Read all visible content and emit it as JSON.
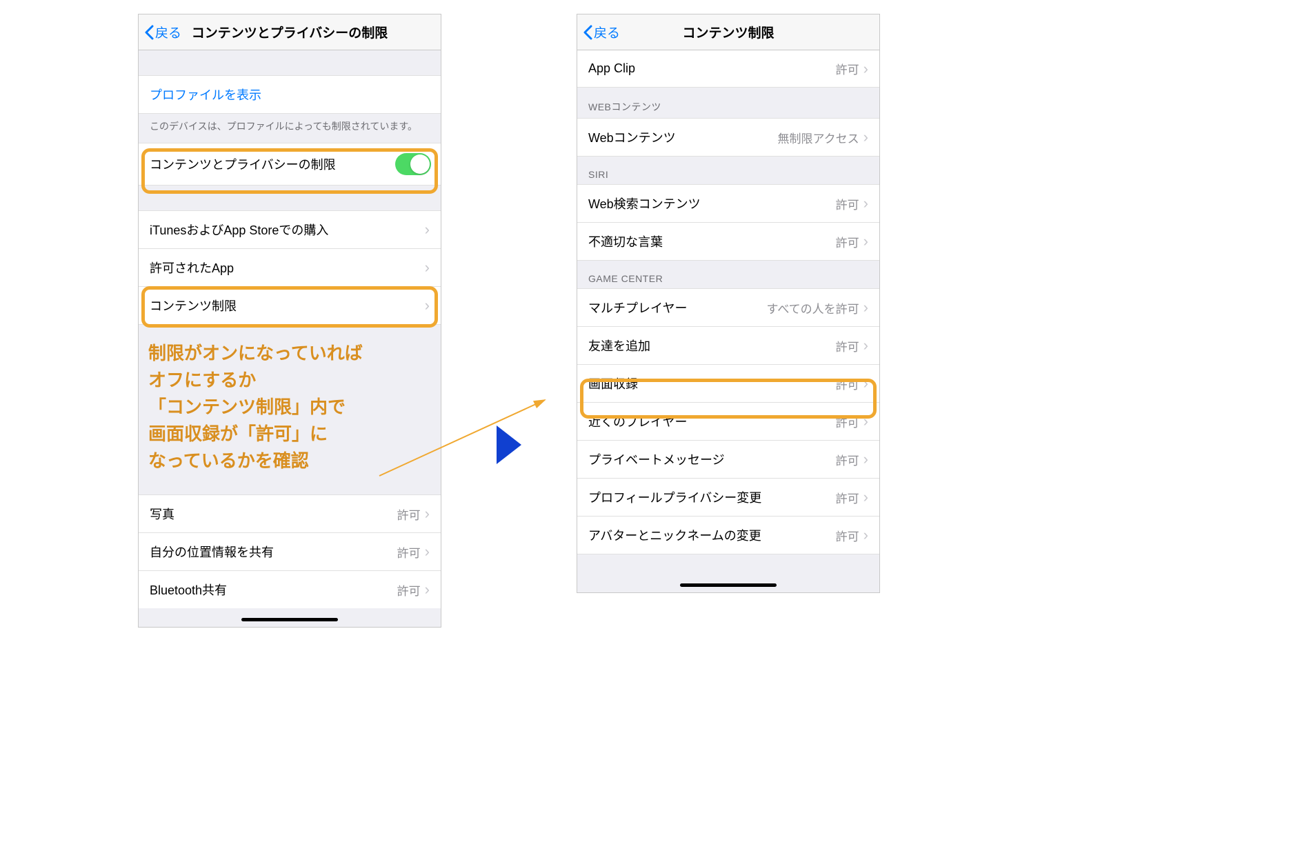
{
  "left": {
    "back": "戻る",
    "title": "コンテンツとプライバシーの制限",
    "profile_link": "プロファイルを表示",
    "profile_footer": "このデバイスは、プロファイルによっても制限されています。",
    "restrict_toggle": "コンテンツとプライバシーの制限",
    "rows": [
      {
        "label": "iTunesおよびApp Storeでの購入"
      },
      {
        "label": "許可されたApp"
      },
      {
        "label": "コンテンツ制限"
      }
    ],
    "lower": [
      {
        "label": "写真",
        "value": "許可"
      },
      {
        "label": "自分の位置情報を共有",
        "value": "許可"
      },
      {
        "label": "Bluetooth共有",
        "value": "許可"
      }
    ]
  },
  "right": {
    "back": "戻る",
    "title": "コンテンツ制限",
    "appclip": {
      "label": "App Clip",
      "value": "許可"
    },
    "sections": [
      {
        "header": "WEBコンテンツ",
        "rows": [
          {
            "label": "Webコンテンツ",
            "value": "無制限アクセス"
          }
        ]
      },
      {
        "header": "SIRI",
        "rows": [
          {
            "label": "Web検索コンテンツ",
            "value": "許可"
          },
          {
            "label": "不適切な言葉",
            "value": "許可"
          }
        ]
      },
      {
        "header": "GAME CENTER",
        "rows": [
          {
            "label": "マルチプレイヤー",
            "value": "すべての人を許可"
          },
          {
            "label": "友達を追加",
            "value": "許可"
          },
          {
            "label": "画面収録",
            "value": "許可"
          },
          {
            "label": "近くのプレイヤー",
            "value": "許可"
          },
          {
            "label": "プライベートメッセージ",
            "value": "許可"
          },
          {
            "label": "プロフィールプライバシー変更",
            "value": "許可"
          },
          {
            "label": "アバターとニックネームの変更",
            "value": "許可"
          }
        ]
      }
    ]
  },
  "annotation": "制限がオンになっていれば\nオフにするか\n「コンテンツ制限」内で\n画面収録が「許可」に\nなっているかを確認"
}
